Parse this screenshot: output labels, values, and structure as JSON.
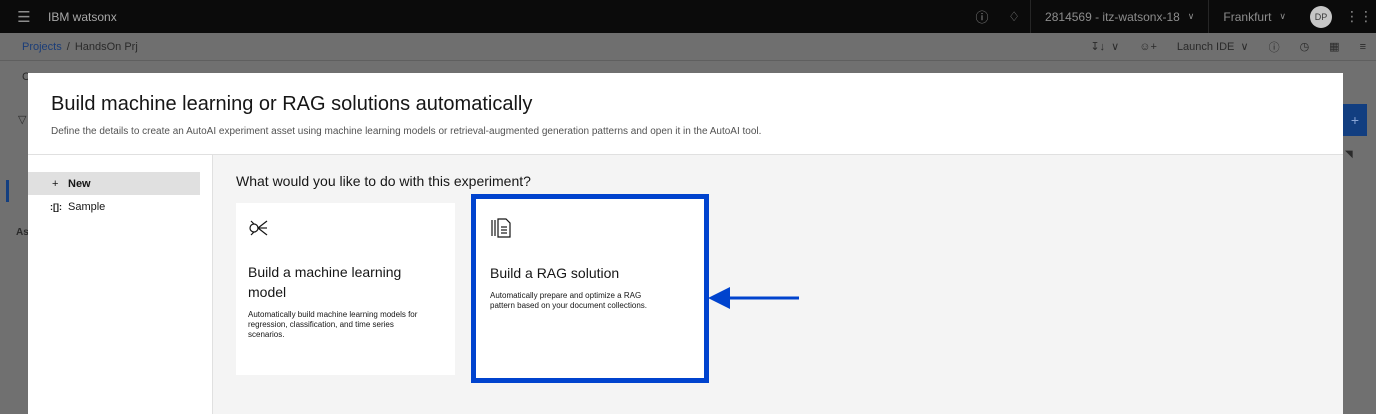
{
  "header": {
    "brand": "IBM watsonx",
    "account": "2814569 - itz-watsonx-18",
    "region": "Frankfurt",
    "avatar_initials": "DP"
  },
  "subbar": {
    "breadcrumb_projects": "Projects",
    "breadcrumb_sep": "/",
    "breadcrumb_current": "HandsOn Prj",
    "launch_ide": "Launch IDE"
  },
  "background": {
    "letter_c": "C",
    "letter_as": "As"
  },
  "modal": {
    "title": "Build machine learning or RAG solutions automatically",
    "description": "Define the details to create an AutoAI experiment asset using machine learning models or retrieval-augmented generation patterns and open it in the AutoAI tool.",
    "nav": [
      {
        "icon": "+",
        "label": "New"
      },
      {
        "icon": ":[]:",
        "label": "Sample"
      }
    ],
    "question": "What would you like to do with this experiment?",
    "tiles": [
      {
        "title": "Build a machine learning model",
        "description": "Automatically build machine learning models for regression, classification, and time series scenarios."
      },
      {
        "title": "Build a RAG solution",
        "description": "Automatically prepare and optimize a RAG pattern based on your document collections."
      }
    ]
  },
  "colors": {
    "highlight": "#0043ce",
    "arrow": "#0043ce"
  }
}
